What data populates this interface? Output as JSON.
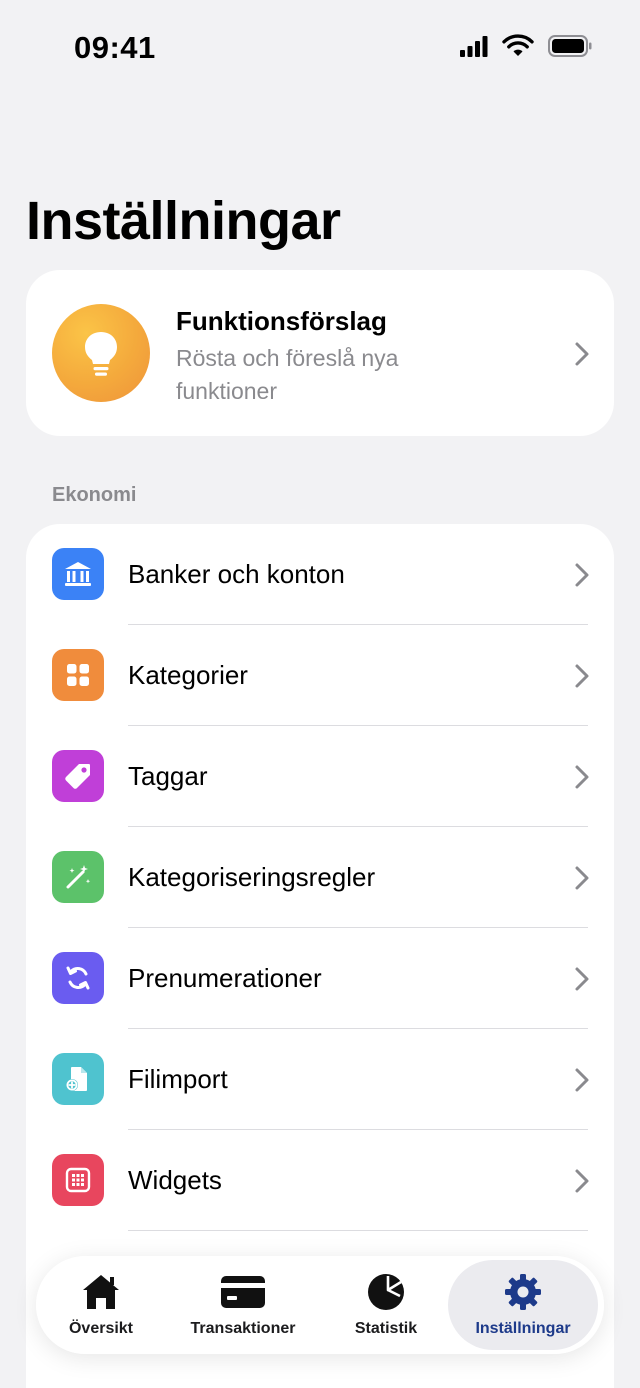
{
  "status": {
    "time": "09:41"
  },
  "page": {
    "title": "Inställningar"
  },
  "feature_card": {
    "title": "Funktionsförslag",
    "subtitle": "Rösta och föreslå nya funktioner"
  },
  "section": {
    "economy_header": "Ekonomi"
  },
  "economy_items": [
    {
      "label": "Banker och konton",
      "icon": "bank-icon",
      "color": "#3b82f6"
    },
    {
      "label": "Kategorier",
      "icon": "grid-icon",
      "color": "#f08c3c"
    },
    {
      "label": "Taggar",
      "icon": "tag-icon",
      "color": "#c03fd8"
    },
    {
      "label": "Kategoriseringsregler",
      "icon": "magic-wand-icon",
      "color": "#5cc26a"
    },
    {
      "label": "Prenumerationer",
      "icon": "refresh-icon",
      "color": "#6a5cf0"
    },
    {
      "label": "Filimport",
      "icon": "file-import-icon",
      "color": "#4fc3cf"
    },
    {
      "label": "Widgets",
      "icon": "widgets-icon",
      "color": "#e8465e"
    }
  ],
  "tabs": [
    {
      "label": "Översikt",
      "icon": "house-icon"
    },
    {
      "label": "Transaktioner",
      "icon": "card-icon"
    },
    {
      "label": "Statistik",
      "icon": "pie-chart-icon"
    },
    {
      "label": "Inställningar",
      "icon": "gear-icon",
      "active": true
    }
  ],
  "colors": {
    "active_tab": "#1d3a8a",
    "accent_gold": "#f4a93c",
    "background": "#f2f2f4"
  }
}
